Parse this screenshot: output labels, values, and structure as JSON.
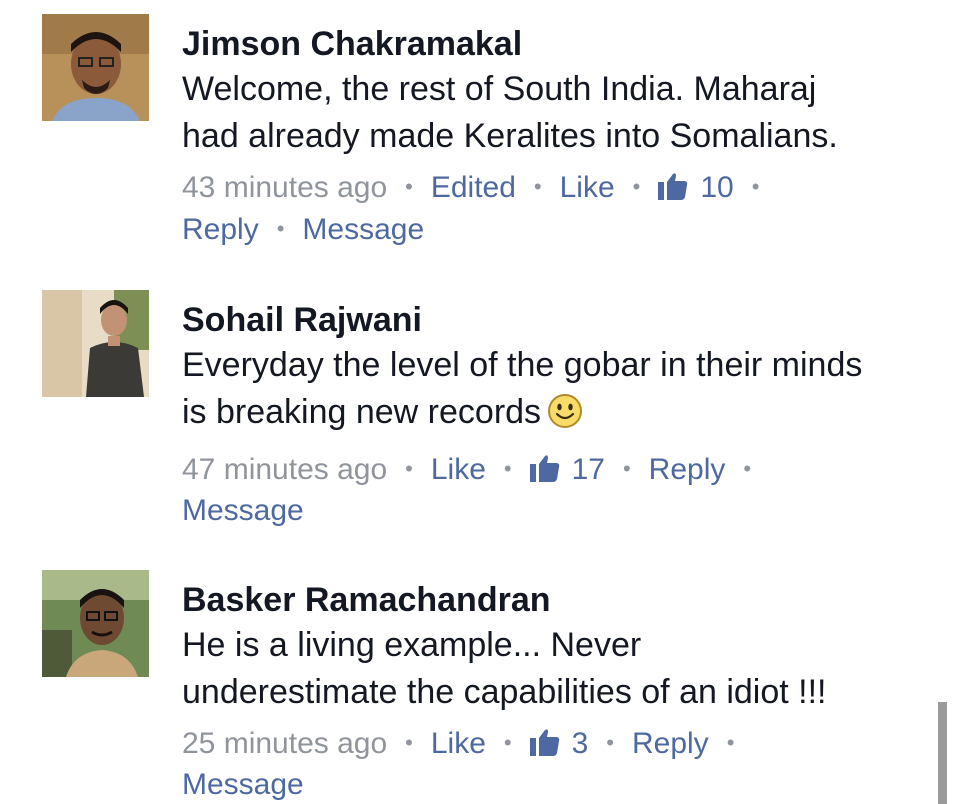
{
  "comments": [
    {
      "author": "Jimson Chakramakal",
      "text_line1": "Welcome, the rest of South India. Maharaj",
      "text_line2": "had already made Keralites into Somalians.",
      "time": "43 minutes ago",
      "edited": "Edited",
      "like": "Like",
      "likes": "10",
      "reply": "Reply",
      "message": "Message"
    },
    {
      "author": "Sohail Rajwani",
      "text_line1": "Everyday the level of the gobar in their minds",
      "text_line2": "is breaking new records",
      "emoji": "smiley-emoji",
      "time": "47 minutes ago",
      "like": "Like",
      "likes": "17",
      "reply": "Reply",
      "message": "Message"
    },
    {
      "author": "Basker Ramachandran",
      "text_line1": "He is a living example... Never",
      "text_line2": "underestimate the capabilities of an idiot !!!",
      "time": "25 minutes ago",
      "like": "Like",
      "likes": "3",
      "reply": "Reply",
      "message": "Message"
    }
  ],
  "separator": "•",
  "colors": {
    "link": "#4e69a2",
    "meta_gray": "#90949c",
    "text": "#141823"
  }
}
